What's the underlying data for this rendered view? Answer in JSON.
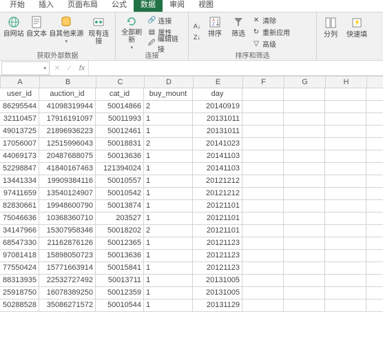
{
  "tabs": {
    "start": "开始",
    "insert": "插入",
    "layout": "页面布局",
    "formulas": "公式",
    "data": "数据",
    "review": "审阅",
    "view": "视图"
  },
  "ribbon": {
    "external": {
      "from_web": "自网站",
      "from_text": "自文本",
      "from_other": "自其他来源",
      "existing": "现有连接",
      "group": "获取外部数据"
    },
    "conn": {
      "refresh": "全部刷新",
      "connections": "连接",
      "properties": "属性",
      "editlinks": "编辑链接",
      "group": "连接"
    },
    "sort": {
      "asc": "A↓Z",
      "desc": "Z↓A",
      "sort": "排序",
      "filter": "筛选",
      "clear": "清除",
      "reapply": "重新应用",
      "advanced": "高级",
      "group": "排序和筛选"
    },
    "tools": {
      "texttocols": "分列",
      "flashfill": "快速填"
    }
  },
  "namebox": "",
  "fx": "fx",
  "columns": [
    "A",
    "B",
    "C",
    "D",
    "E",
    "F",
    "G",
    "H"
  ],
  "headers": [
    "user_id",
    "auction_id",
    "cat_id",
    "buy_mount",
    "day"
  ],
  "rows": [
    [
      "86295544",
      "41098319944",
      "50014866",
      "2",
      "20140919"
    ],
    [
      "32110457",
      "17916191097",
      "50011993",
      "1",
      "20131011"
    ],
    [
      "49013725",
      "21896936223",
      "50012461",
      "1",
      "20131011"
    ],
    [
      "17056007",
      "12515996043",
      "50018831",
      "2",
      "20141023"
    ],
    [
      "44069173",
      "20487688075",
      "50013636",
      "1",
      "20141103"
    ],
    [
      "52298847",
      "41840167463",
      "121394024",
      "1",
      "20141103"
    ],
    [
      "13441334",
      "19909384116",
      "50010557",
      "1",
      "20121212"
    ],
    [
      "97411659",
      "13540124907",
      "50010542",
      "1",
      "20121212"
    ],
    [
      "82830661",
      "19948600790",
      "50013874",
      "1",
      "20121101"
    ],
    [
      "75046636",
      "10368360710",
      "203527",
      "1",
      "20121101"
    ],
    [
      "34147966",
      "15307958346",
      "50018202",
      "2",
      "20121101"
    ],
    [
      "68547330",
      "21162876126",
      "50012365",
      "1",
      "20121123"
    ],
    [
      "97081418",
      "15898050723",
      "50013636",
      "1",
      "20121123"
    ],
    [
      "77550424",
      "15771663914",
      "50015841",
      "1",
      "20121123"
    ],
    [
      "88313935",
      "22532727492",
      "50013711",
      "1",
      "20131005"
    ],
    [
      "25918750",
      "16078389250",
      "50012359",
      "1",
      "20131005"
    ],
    [
      "50288528",
      "35086271572",
      "50010544",
      "1",
      "20131129"
    ]
  ]
}
